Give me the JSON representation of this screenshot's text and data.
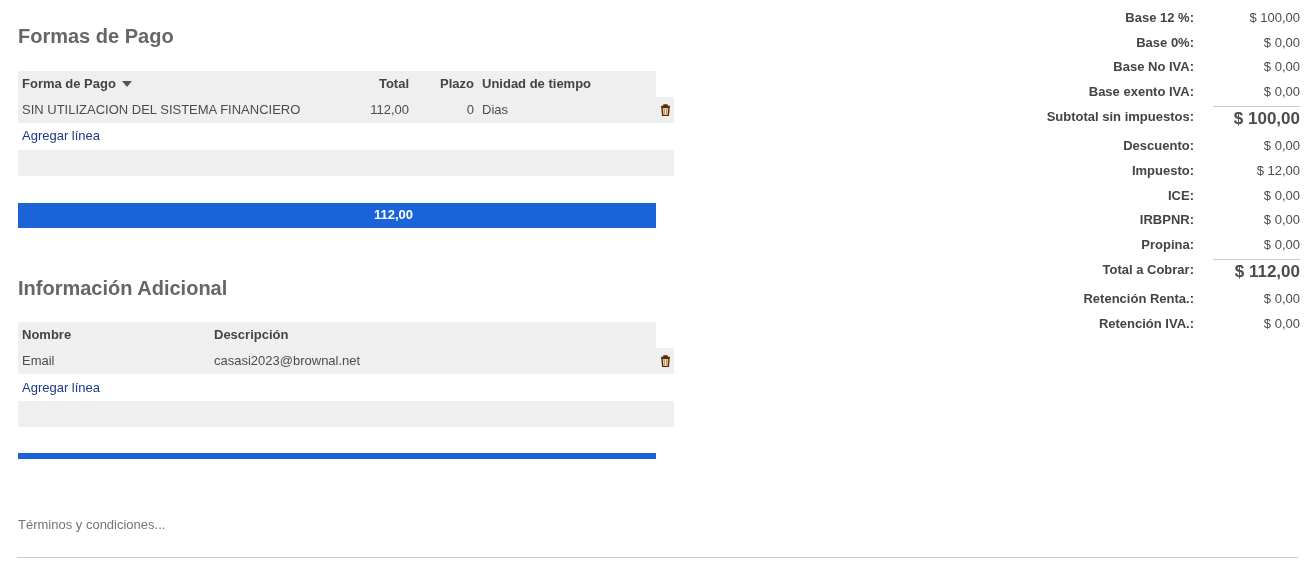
{
  "payments": {
    "title": "Formas de Pago",
    "columns": [
      {
        "label": "Forma de Pago",
        "sorted": true
      },
      {
        "label": "Total",
        "sorted": false
      },
      {
        "label": "Plazo",
        "sorted": false
      },
      {
        "label": "Unidad de tiempo",
        "sorted": false
      }
    ],
    "rows": [
      [
        "SIN UTILIZACION DEL SISTEMA FINANCIERO",
        "112,00",
        "0",
        "Dias"
      ]
    ],
    "add_line": "Agregar línea",
    "footer_total": "112,00"
  },
  "additional_info": {
    "title": "Información Adicional",
    "columns": [
      {
        "label": "Nombre"
      },
      {
        "label": "Descripción"
      }
    ],
    "rows": [
      [
        "Email",
        "casasi2023@brownal.net"
      ]
    ],
    "add_line": "Agregar línea"
  },
  "terms": {
    "placeholder": "Términos y condiciones..."
  },
  "summary": [
    {
      "label": "Base 12 %:",
      "value": "$ 100,00",
      "kind": "normal"
    },
    {
      "label": "Base 0%:",
      "value": "$ 0,00",
      "kind": "normal"
    },
    {
      "label": "Base No IVA:",
      "value": "$ 0,00",
      "kind": "normal"
    },
    {
      "label": "Base exento IVA:",
      "value": "$ 0,00",
      "kind": "normal"
    },
    {
      "label": "Subtotal sin impuestos:",
      "value": "$ 100,00",
      "kind": "total"
    },
    {
      "label": "Descuento:",
      "value": "$ 0,00",
      "kind": "normal"
    },
    {
      "label": "Impuesto:",
      "value": "$ 12,00",
      "kind": "normal"
    },
    {
      "label": "ICE:",
      "value": "$ 0,00",
      "kind": "normal"
    },
    {
      "label": "IRBPNR:",
      "value": "$ 0,00",
      "kind": "normal"
    },
    {
      "label": "Propina:",
      "value": "$ 0,00",
      "kind": "normal"
    },
    {
      "label": "Total a Cobrar:",
      "value": "$ 112,00",
      "kind": "total"
    },
    {
      "label": "Retención Renta.:",
      "value": "$ 0,00",
      "kind": "normal"
    },
    {
      "label": "Retención IVA.:",
      "value": "$ 0,00",
      "kind": "normal"
    }
  ]
}
